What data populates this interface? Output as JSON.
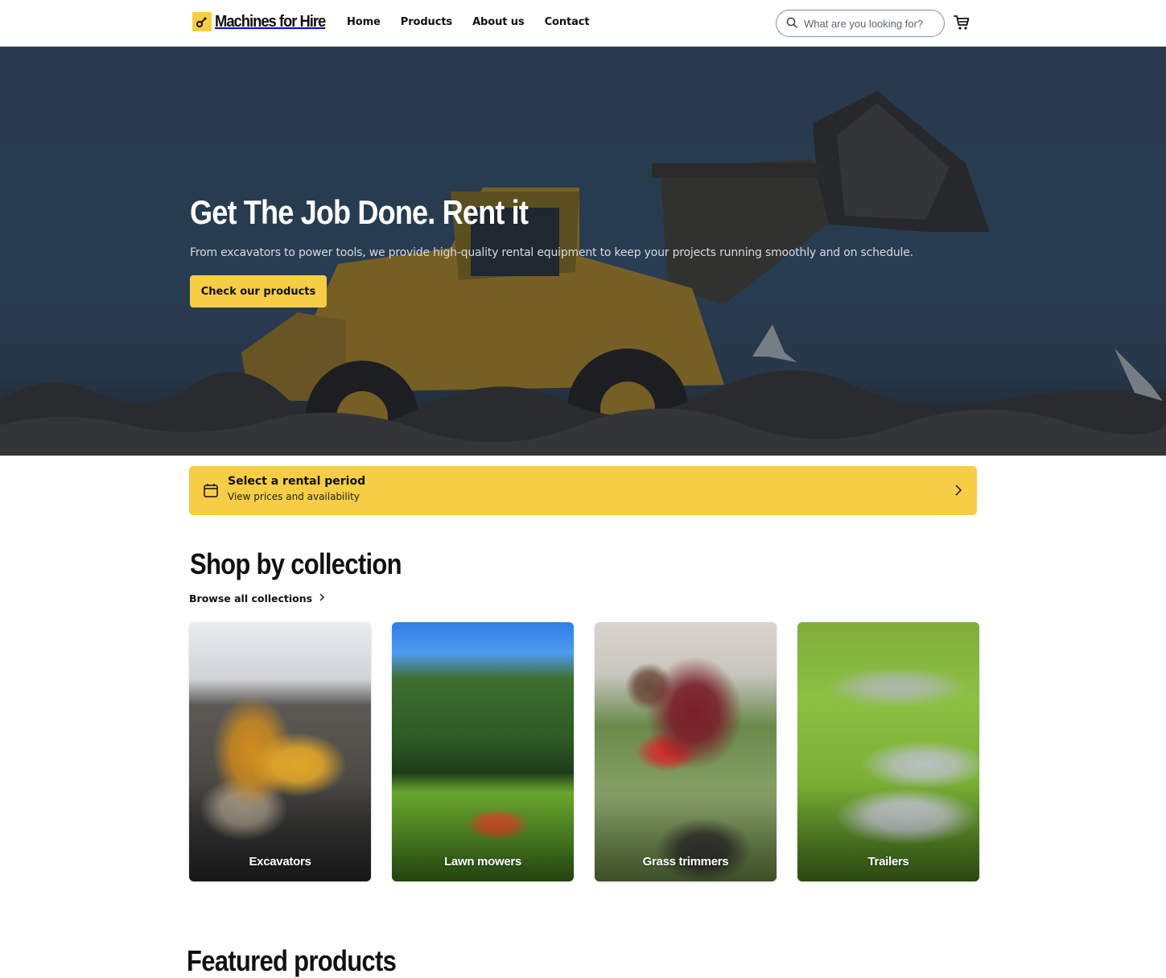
{
  "header": {
    "brand": "Machines for Hire",
    "brand_color": "#f6cd45",
    "nav": [
      {
        "label": "Home"
      },
      {
        "label": "Products"
      },
      {
        "label": "About us"
      },
      {
        "label": "Contact"
      }
    ],
    "search": {
      "placeholder": "What are you looking for?",
      "value": "",
      "icon": "search-icon"
    },
    "cart_icon": "cart-icon"
  },
  "hero": {
    "title": "Get The Job Done. Rent it",
    "subtitle": "From excavators to power tools, we provide high-quality rental equipment to keep your projects running smoothly and on schedule.",
    "cta_label": "Check our products"
  },
  "rental_bar": {
    "icon": "calendar-icon",
    "title": "Select a rental period",
    "subtitle": "View prices and availability",
    "chevron_icon": "chevron-right-icon"
  },
  "collections": {
    "title": "Shop by collection",
    "browse_label": "Browse all collections",
    "items": [
      {
        "label": "Excavators"
      },
      {
        "label": "Lawn mowers"
      },
      {
        "label": "Grass trimmers"
      },
      {
        "label": "Trailers"
      }
    ]
  },
  "featured": {
    "title": "Featured products"
  }
}
